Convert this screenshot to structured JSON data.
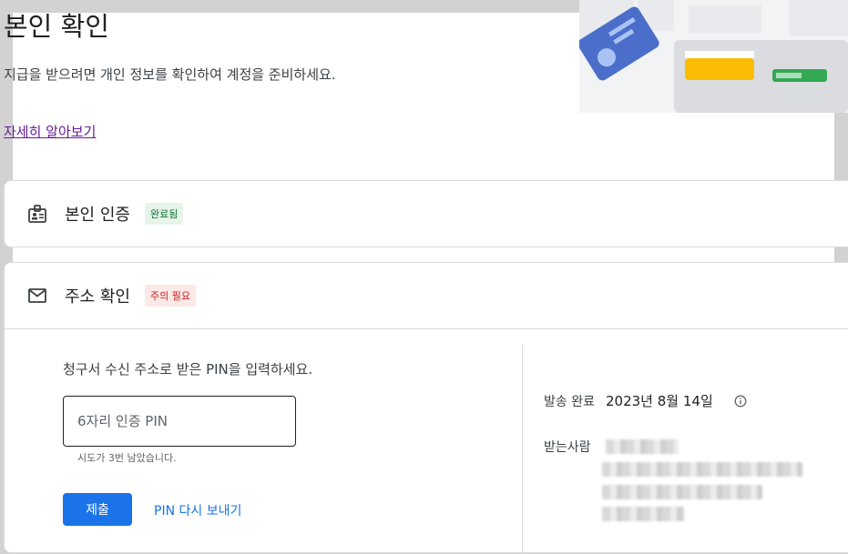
{
  "page": {
    "title": "본인 확인",
    "description": "지급을 받으려면 개인 정보를 확인하여 계정을 준비하세요.",
    "learn_more": "자세히 알아보기"
  },
  "identity_section": {
    "label": "본인 인증",
    "badge": "완료됨",
    "icon": "id-badge-icon"
  },
  "address_section": {
    "label": "주소 확인",
    "badge": "주의 필요",
    "icon": "mail-icon",
    "prompt": "청구서 수신 주소로 받은 PIN을 입력하세요.",
    "pin_placeholder": "6자리 인증 PIN",
    "attempts_left": "시도가 3번 남았습니다.",
    "submit_label": "제출",
    "resend_label": "PIN 다시 보내기",
    "sent_label": "발송 완료",
    "sent_date": "2023년 8월 14일",
    "recipient_label": "받는사람"
  },
  "colors": {
    "accent": "#1a73e8",
    "success_bg": "#e6f4ea",
    "success_text": "#137333",
    "warn_bg": "#fce8e6",
    "warn_text": "#c5221f",
    "link_visited": "#6a1b9a"
  }
}
